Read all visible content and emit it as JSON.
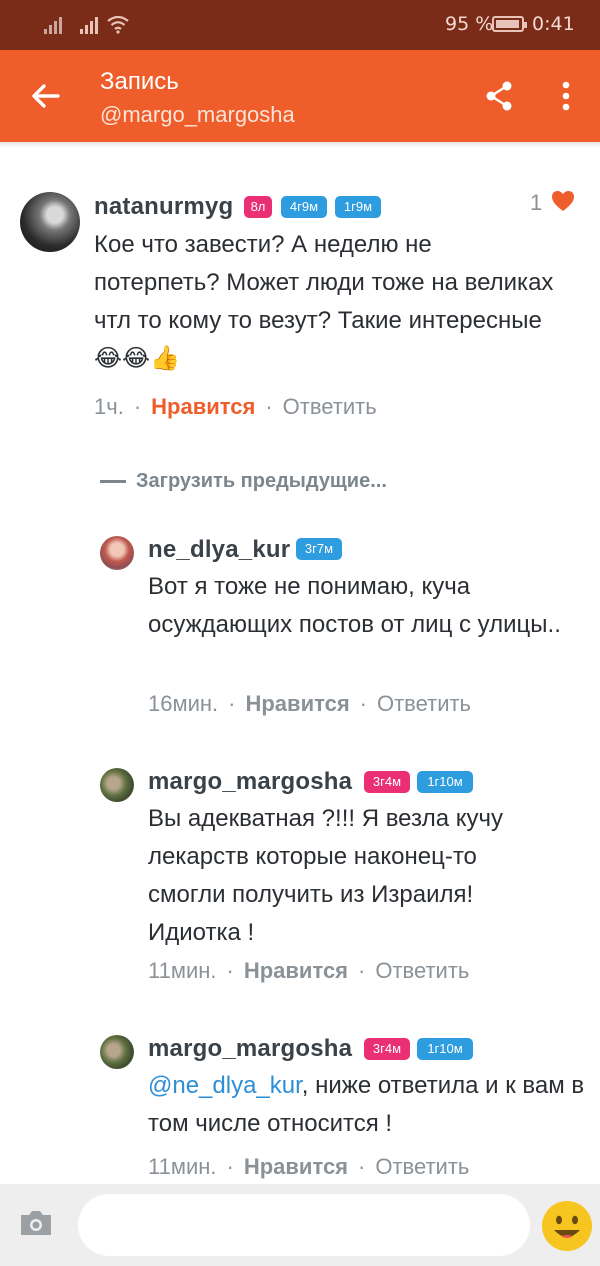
{
  "status_bar": {
    "battery_percent": "95 %",
    "time": "0:41"
  },
  "toolbar": {
    "title": "Запись",
    "subtitle": "@margo_margosha"
  },
  "post_comment": {
    "username": "natanurmyg",
    "badges": [
      "8л",
      "4г9м",
      "1г9м"
    ],
    "text": "Кое что завести? А неделю не потерпеть? Может люди тоже на великах чтл то кому то везут? Такие интересные 😂😂👍",
    "time": "1ч.",
    "like_label": "Нравится",
    "reply_label": "Ответить",
    "likes_count": "1"
  },
  "load_previous": "Загрузить предыдущие...",
  "replies": [
    {
      "username": "ne_dlya_kur",
      "badges": [
        "3г7м"
      ],
      "text": "Вот я тоже не понимаю, куча осуждающих постов от лиц с улицы..",
      "time": "16мин.",
      "like_label": "Нравится",
      "reply_label": "Ответить"
    },
    {
      "username": "margo_margosha",
      "badges": [
        "3г4м",
        "1г10м"
      ],
      "text": "Вы адекватная ?!!! Я везла кучу лекарств  которые наконец-то смогли получить из Израиля! Идиотка !",
      "time": "11мин.",
      "like_label": "Нравится",
      "reply_label": "Ответить"
    },
    {
      "username": "margo_margosha",
      "badges": [
        "3г4м",
        "1г10м"
      ],
      "mention": "@ne_dlya_kur",
      "text": ", ниже ответила и к вам в том числе относится !",
      "time": "11мин.",
      "like_label": "Нравится",
      "reply_label": "Ответить"
    }
  ],
  "composer": {
    "placeholder": ""
  },
  "colors": {
    "accent": "#ee5d2a",
    "status_bar": "#7a2c19",
    "badge_pink": "#ea2f74",
    "badge_blue": "#2d9de0",
    "mention": "#2d8fd6"
  },
  "icons": [
    "back-arrow-icon",
    "share-icon",
    "more-vert-icon",
    "heart-icon",
    "camera-icon",
    "smiley-icon"
  ]
}
